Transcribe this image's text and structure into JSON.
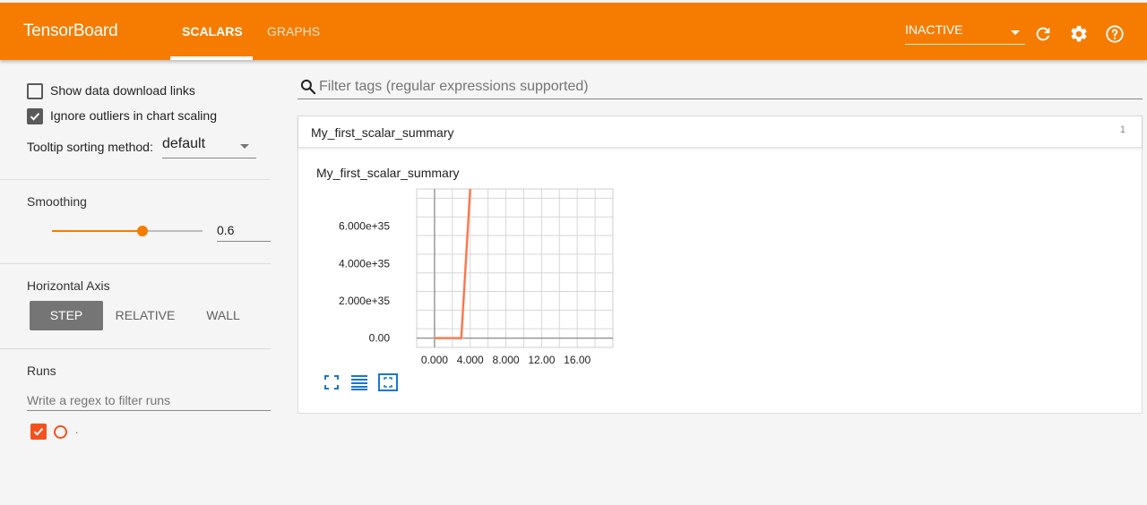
{
  "header": {
    "app_title": "TensorBoard",
    "tabs": [
      {
        "label": "SCALARS",
        "active": true
      },
      {
        "label": "GRAPHS",
        "active": false
      }
    ],
    "run_selector": "INACTIVE",
    "icons": [
      "refresh-icon",
      "settings-icon",
      "help-icon"
    ],
    "colors": {
      "brand": "#f57c00"
    }
  },
  "sidebar": {
    "show_download_links": {
      "label": "Show data download links",
      "checked": false
    },
    "ignore_outliers": {
      "label": "Ignore outliers in chart scaling",
      "checked": true
    },
    "tooltip_sorting": {
      "label": "Tooltip sorting method:",
      "value": "default"
    },
    "smoothing": {
      "label": "Smoothing",
      "value": "0.6",
      "fraction": 0.6
    },
    "horizontal_axis": {
      "label": "Horizontal Axis",
      "options": [
        "STEP",
        "RELATIVE",
        "WALL"
      ],
      "selected": "STEP"
    },
    "runs": {
      "label": "Runs",
      "filter_placeholder": "Write a regex to filter runs",
      "items": [
        {
          "name": ".",
          "checked": true,
          "color": "#f4511e"
        }
      ]
    }
  },
  "main": {
    "filter_placeholder": "Filter tags (regular expressions supported)",
    "category": {
      "name": "My_first_scalar_summary",
      "count": "1"
    },
    "card": {
      "title": "My_first_scalar_summary",
      "icons": [
        "fullscreen-icon",
        "log-scale-icon",
        "fit-domain-icon"
      ]
    }
  },
  "chart_data": {
    "type": "line",
    "title": "My_first_scalar_summary",
    "xlabel": "",
    "ylabel": "",
    "x_ticks": [
      "0.000",
      "4.000",
      "8.000",
      "12.00",
      "16.00"
    ],
    "y_ticks": [
      "0.00",
      "2.000e+35",
      "4.000e+35",
      "6.000e+35"
    ],
    "xlim": [
      -2,
      20
    ],
    "ylim": [
      -5e+34,
      8e+35
    ],
    "grid": true,
    "series": [
      {
        "x": [
          0,
          1,
          2,
          3,
          4,
          5
        ],
        "y": [
          0,
          0,
          0,
          0,
          8e+35,
          1.6e+36
        ],
        "color": "#ff7043",
        "smoothed": true
      },
      {
        "x": [
          0,
          1,
          2,
          3,
          4,
          5
        ],
        "y": [
          0,
          0,
          0,
          0,
          8e+35,
          1.6e+36
        ],
        "color": "#ffccbc",
        "smoothed": false
      }
    ]
  }
}
